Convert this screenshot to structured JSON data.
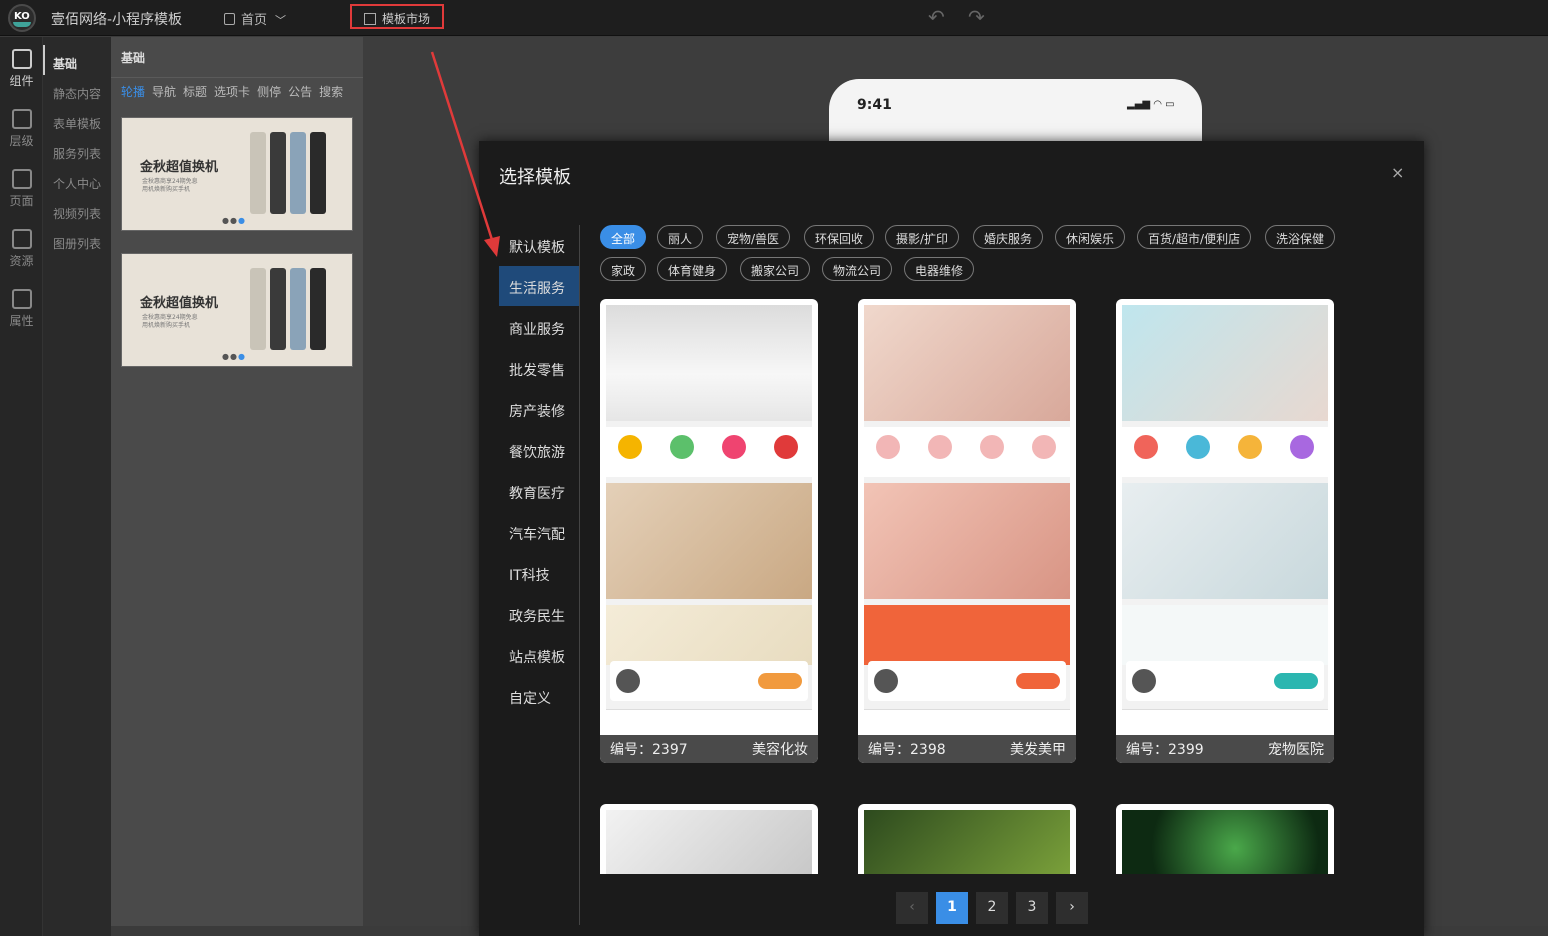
{
  "topbar": {
    "logo_text": "KO",
    "app_title": "壹佰网络-小程序模板",
    "page_select": "首页",
    "template_market": "模板市场"
  },
  "rail": {
    "items": [
      {
        "label": "组件",
        "icon": "grid-icon"
      },
      {
        "label": "层级",
        "icon": "layers-icon"
      },
      {
        "label": "页面",
        "icon": "page-icon"
      },
      {
        "label": "资源",
        "icon": "image-icon"
      },
      {
        "label": "属性",
        "icon": "edit-icon"
      }
    ]
  },
  "subnav": {
    "items": [
      "基础",
      "静态内容",
      "表单模板",
      "服务列表",
      "个人中心",
      "视频列表",
      "图册列表"
    ]
  },
  "panel": {
    "title": "基础",
    "tabs": [
      "轮播",
      "导航",
      "标题",
      "选项卡",
      "侧停",
      "公告",
      "搜索"
    ],
    "banners": [
      {
        "title": "金秋超值换机",
        "subtitle": "金秋惠商享24期免息\n用机焕新购买手机"
      },
      {
        "title": "金秋超值换机",
        "subtitle": "金秋惠商享24期免息\n用机焕新购买手机"
      }
    ]
  },
  "phone": {
    "time": "9:41"
  },
  "modal": {
    "title": "选择模板",
    "close": "×",
    "nav": [
      "默认模板",
      "生活服务",
      "商业服务",
      "批发零售",
      "房产装修",
      "餐饮旅游",
      "教育医疗",
      "汽车汽配",
      "IT科技",
      "政务民生",
      "站点模板",
      "自定义"
    ],
    "active_nav": "生活服务",
    "filters_row1": [
      "全部",
      "丽人",
      "宠物/兽医",
      "环保回收",
      "摄影/扩印",
      "婚庆服务",
      "休闲娱乐",
      "百货/超市/便利店",
      "洗浴保健"
    ],
    "filters_row2": [
      "家政",
      "体育健身",
      "搬家公司",
      "物流公司",
      "电器维修"
    ],
    "active_filter": "全部",
    "cards": [
      {
        "id_label": "编号：2397",
        "category": "美容化妆",
        "accent": "#f19a3e"
      },
      {
        "id_label": "编号：2398",
        "category": "美发美甲",
        "accent": "#f0643a"
      },
      {
        "id_label": "编号：2399",
        "category": "宠物医院",
        "accent": "#2bb6b0"
      }
    ],
    "pager": {
      "prev": "‹",
      "pages": [
        "1",
        "2",
        "3"
      ],
      "current": "1",
      "next": "›"
    }
  },
  "colors": {
    "accent": "#3a8ee6",
    "highlight": "#e03a3a"
  }
}
